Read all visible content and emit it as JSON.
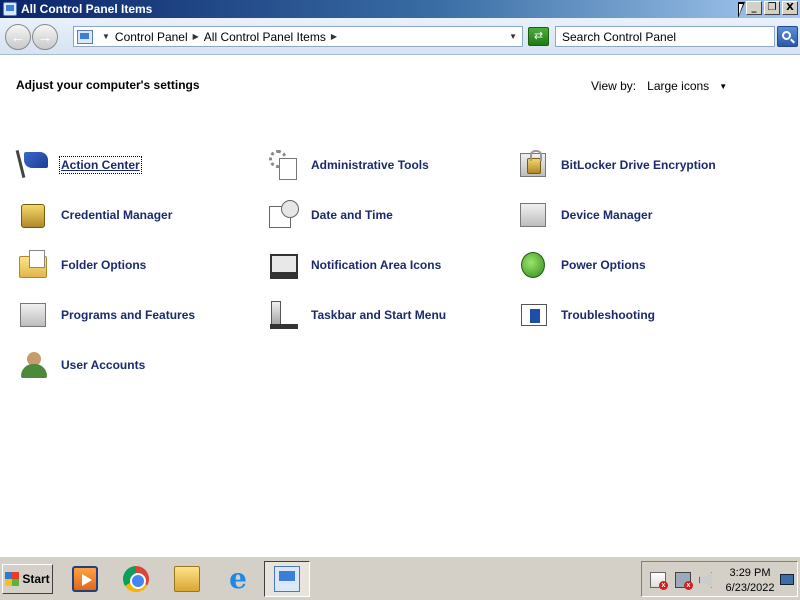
{
  "window": {
    "title": "All Control Panel Items",
    "buttons": [
      "_",
      "❐",
      "X"
    ]
  },
  "navbar": {
    "breadcrumb": [
      "Control Panel",
      "All Control Panel Items"
    ],
    "search_placeholder": "Search Control Panel"
  },
  "content": {
    "heading": "Adjust your computer's settings",
    "view_by_label": "View by:",
    "view_by_value": "Large icons",
    "items": [
      {
        "label": "Action Center",
        "icon": "action-center-flag-icon"
      },
      {
        "label": "Administrative Tools",
        "icon": "administrative-tools-icon"
      },
      {
        "label": "BitLocker Drive Encryption",
        "icon": "bitlocker-icon"
      },
      {
        "label": "Credential Manager",
        "icon": "credential-manager-icon"
      },
      {
        "label": "Date and Time",
        "icon": "date-time-icon"
      },
      {
        "label": "Device Manager",
        "icon": "device-manager-icon"
      },
      {
        "label": "Folder Options",
        "icon": "folder-options-icon"
      },
      {
        "label": "Notification Area Icons",
        "icon": "notification-area-icon"
      },
      {
        "label": "Power Options",
        "icon": "power-options-icon"
      },
      {
        "label": "Programs and Features",
        "icon": "programs-features-icon"
      },
      {
        "label": "Taskbar and Start Menu",
        "icon": "taskbar-start-menu-icon"
      },
      {
        "label": "Troubleshooting",
        "icon": "troubleshooting-icon"
      },
      {
        "label": "User Accounts",
        "icon": "user-accounts-icon"
      }
    ]
  },
  "taskbar": {
    "start_label": "Start",
    "apps": [
      "windows-media-player-icon",
      "chrome-icon",
      "windows-explorer-icon",
      "internet-explorer-icon",
      "control-panel-icon"
    ],
    "active_app": "control-panel-icon",
    "clock_time": "3:29 PM",
    "clock_date": "6/23/2022"
  },
  "colors": {
    "title_bar_start": "#0a246a",
    "link_text": "#1a2a6c",
    "taskbar": "#d4d0c8"
  }
}
